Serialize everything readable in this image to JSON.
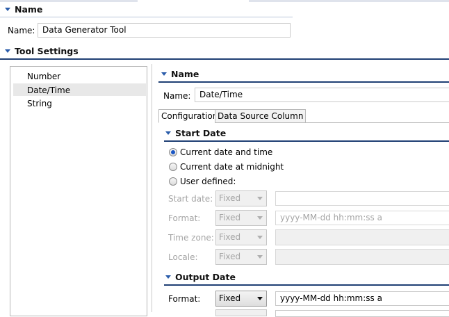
{
  "name_section": {
    "title": "Name",
    "field_label": "Name:",
    "value": "Data Generator Tool"
  },
  "tool_settings": {
    "title": "Tool Settings",
    "tree_items": [
      "Number",
      "Date/Time",
      "String"
    ],
    "selected_item": "Date/Time"
  },
  "detail": {
    "name_title": "Name",
    "name_label": "Name:",
    "name_value": "Date/Time",
    "tabs": [
      "Configuration",
      "Data Source Column"
    ],
    "active_tab": "Configuration"
  },
  "start_date": {
    "title": "Start Date",
    "options": [
      "Current date and time",
      "Current date at midnight",
      "User defined:"
    ],
    "selected_option": "Current date and time",
    "fields": [
      {
        "label": "Start date:",
        "combo": "Fixed",
        "value": ""
      },
      {
        "label": "Format:",
        "combo": "Fixed",
        "value": "yyyy-MM-dd hh:mm:ss a"
      },
      {
        "label": "Time zone:",
        "combo": "Fixed",
        "value": ""
      },
      {
        "label": "Locale:",
        "combo": "Fixed",
        "value": ""
      }
    ]
  },
  "output_date": {
    "title": "Output Date",
    "format_label": "Format:",
    "format_combo": "Fixed",
    "format_value": "yyyy-MM-dd hh:mm:ss a"
  },
  "colors": {
    "section_rule": "#1f3f74",
    "selection": "#e8e8e8",
    "radio_dot": "#1b57c5"
  }
}
